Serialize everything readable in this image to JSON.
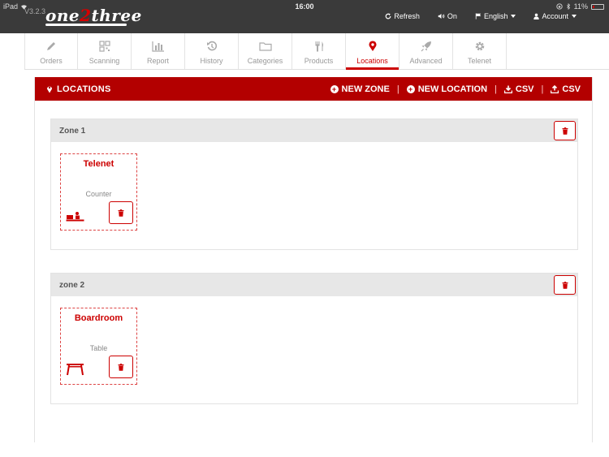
{
  "status": {
    "device": "iPad",
    "time": "16:00",
    "battery": "11%"
  },
  "app": {
    "version": "V3.2.3",
    "logo_one": "one",
    "logo_two": "2",
    "logo_three": "three"
  },
  "topnav": [
    {
      "label": "Refresh",
      "icon": "refresh-icon"
    },
    {
      "label": "On",
      "icon": "speaker-icon"
    },
    {
      "label": "English",
      "icon": "flag-icon"
    },
    {
      "label": "Account",
      "icon": "user-icon"
    }
  ],
  "tabs": [
    {
      "label": "Orders",
      "icon": "pencil-icon"
    },
    {
      "label": "Scanning",
      "icon": "qrcode-icon"
    },
    {
      "label": "Report",
      "icon": "bar-chart-icon"
    },
    {
      "label": "History",
      "icon": "history-icon"
    },
    {
      "label": "Categories",
      "icon": "folder-icon"
    },
    {
      "label": "Products",
      "icon": "cutlery-icon"
    },
    {
      "label": "Locations",
      "icon": "map-marker-icon",
      "active": true
    },
    {
      "label": "Advanced",
      "icon": "rocket-icon"
    },
    {
      "label": "Telenet",
      "icon": "gear-icon"
    }
  ],
  "panel": {
    "title": "LOCATIONS",
    "new_zone": "NEW ZONE",
    "new_location": "NEW LOCATION",
    "csv_download": "CSV",
    "csv_upload": "CSV",
    "separator": "|"
  },
  "zones": [
    {
      "name": "Zone 1",
      "location": {
        "name": "Telenet",
        "type": "Counter",
        "icon": "counter-icon"
      }
    },
    {
      "name": "zone 2",
      "location": {
        "name": "Boardroom",
        "type": "Table",
        "icon": "table-icon"
      }
    }
  ],
  "colors": {
    "accent": "#b30000",
    "header_bg": "#3a3a3a"
  }
}
